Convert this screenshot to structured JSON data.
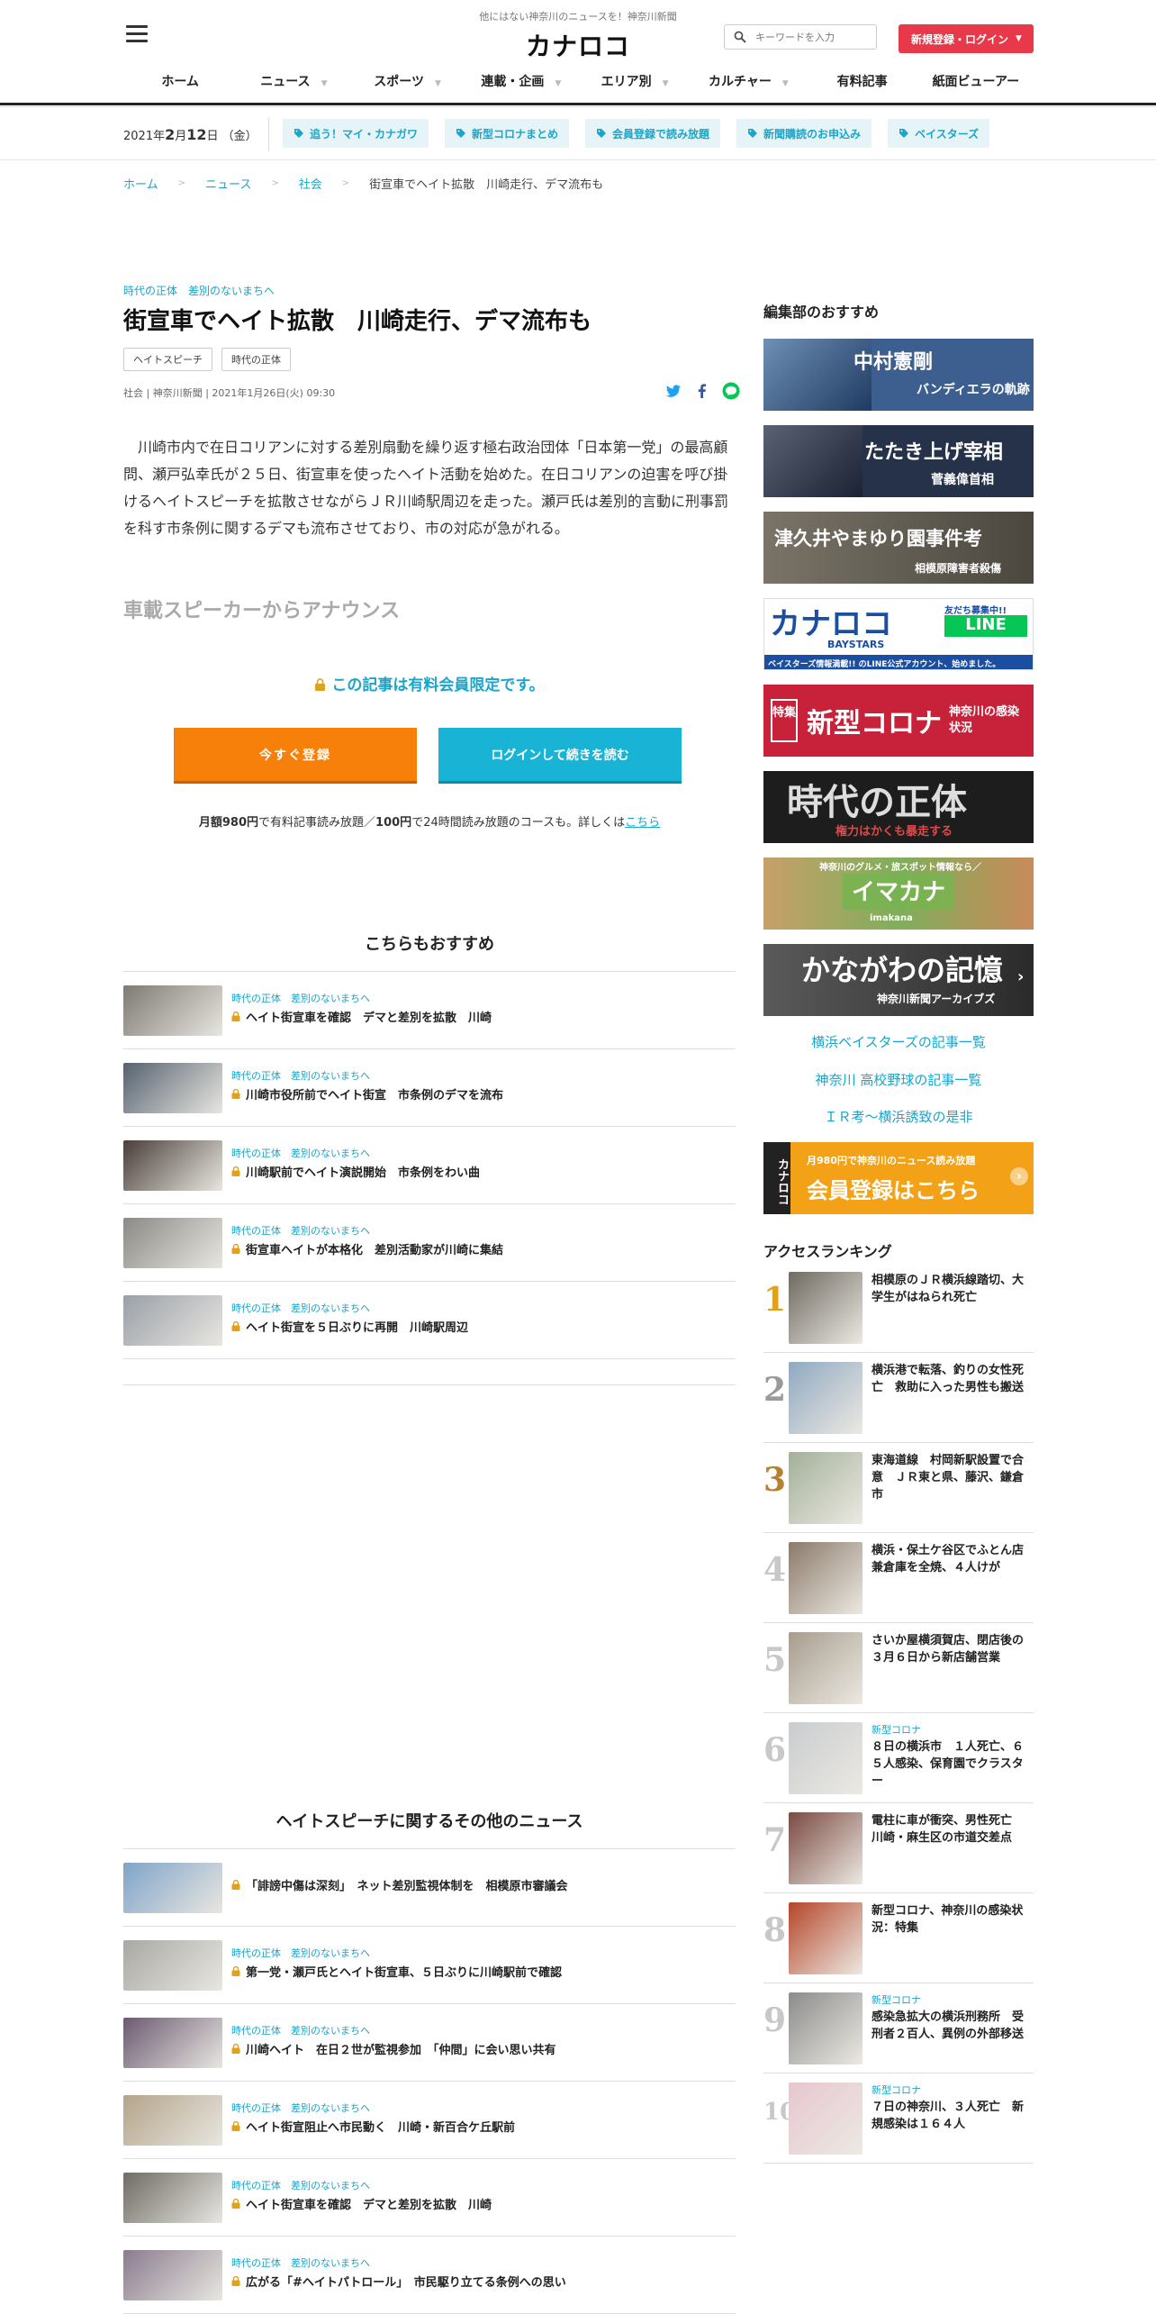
{
  "header": {
    "tagline": "他にはない神奈川のニュースを！神奈川新聞",
    "logo": "カナロコ",
    "search_placeholder": "キーワードを入力",
    "signup_label": "新規登録・ログイン"
  },
  "nav": [
    {
      "label": "ホーム",
      "dropdown": false
    },
    {
      "label": "ニュース",
      "dropdown": true
    },
    {
      "label": "スポーツ",
      "dropdown": true
    },
    {
      "label": "連載・企画",
      "dropdown": true
    },
    {
      "label": "エリア別",
      "dropdown": true
    },
    {
      "label": "カルチャー",
      "dropdown": true
    },
    {
      "label": "有料記事",
      "dropdown": false
    },
    {
      "label": "紙面ビューアー",
      "dropdown": false
    }
  ],
  "datebar": {
    "year": "2021年",
    "month_day_1": "2",
    "month_label": "月",
    "day": "12",
    "day_label": "日",
    "weekday": "（金）",
    "tags": [
      "追う！マイ・カナガワ",
      "新型コロナまとめ",
      "会員登録で読み放題",
      "新聞購読のお申込み",
      "ベイスターズ"
    ]
  },
  "breadcrumb": [
    "ホーム",
    "ニュース",
    "社会",
    "街宣車でヘイト拡散　川崎走行、デマ流布も"
  ],
  "article": {
    "kicker": "時代の正体　差別のないまちへ",
    "title": "街宣車でヘイト拡散　川崎走行、デマ流布も",
    "labels": [
      "ヘイトスピーチ",
      "時代の正体"
    ],
    "meta": "社会 | 神奈川新聞 | 2021年1月26日(火) 09:30",
    "body": "川崎市内で在日コリアンに対する差別扇動を繰り返す極右政治団体「日本第一党」の最高顧問、瀬戸弘幸氏が２５日、街宣車を使ったヘイト活動を始めた。在日コリアンの迫害を呼び掛けるヘイトスピーチを拡散させながらＪＲ川崎駅周辺を走った。瀬戸氏は差別的言動に刑事罰を科す市条例に関するデマも流布させており、市の対応が急がれる。",
    "subhead": "車載スピーカーからアナウンス",
    "paywall_msg": "この記事は有料会員限定です。",
    "register_btn": "今すぐ登録",
    "login_btn": "ログインして続きを読む",
    "plan_note": {
      "price1": "月額980円",
      "text1": "で有料記事読み放題／",
      "price2": "100円",
      "text2": "で24時間読み放題のコースも。詳しくは",
      "link": "こちら"
    }
  },
  "recommend": {
    "title": "こちらもおすすめ",
    "items": [
      {
        "kicker": "時代の正体　差別のないまちへ",
        "title": "ヘイト街宣車を確認　デマと差別を拡散　川崎",
        "thumb": "#7d7a72"
      },
      {
        "kicker": "時代の正体　差別のないまちへ",
        "title": "川崎市役所前でヘイト街宣　市条例のデマを流布",
        "thumb": "#566270"
      },
      {
        "kicker": "時代の正体　差別のないまちへ",
        "title": "川崎駅前でヘイト演説開始　市条例をわい曲",
        "thumb": "#4a3f3a"
      },
      {
        "kicker": "時代の正体　差別のないまちへ",
        "title": "街宣車ヘイトが本格化　差別活動家が川崎に集結",
        "thumb": "#8c8a86"
      },
      {
        "kicker": "時代の正体　差別のないまちへ",
        "title": "ヘイト街宣を５日ぶりに再開　川崎駅周辺",
        "thumb": "#9aa0a8"
      }
    ]
  },
  "related": {
    "title": "ヘイトスピーチに関するその他のニュース",
    "items": [
      {
        "kicker": "",
        "title": "「誹謗中傷は深刻」　ネット差別監視体制を　相模原市審議会",
        "thumb": "#7fa4c9"
      },
      {
        "kicker": "時代の正体　差別のないまちへ",
        "title": "第一党・瀬戸氏とヘイト街宣車、５日ぶりに川崎駅前で確認",
        "thumb": "#a9a8a2"
      },
      {
        "kicker": "時代の正体　差別のないまちへ",
        "title": "川崎ヘイト　在日２世が監視参加　「仲間」に会い思い共有",
        "thumb": "#6b5a72"
      },
      {
        "kicker": "時代の正体　差別のないまちへ",
        "title": "ヘイト街宣阻止へ市民動く　川崎・新百合ケ丘駅前",
        "thumb": "#b4a48a"
      },
      {
        "kicker": "時代の正体　差別のないまちへ",
        "title": "ヘイト街宣車を確認　デマと差別を拡散　川崎",
        "thumb": "#6f6c66"
      },
      {
        "kicker": "時代の正体　差別のないまちへ",
        "title": "広がる「#ヘイトパトロール」　市民駆り立てる条例への思い",
        "thumb": "#8a7c8e"
      }
    ]
  },
  "sidebar": {
    "editors_title": "編集部のおすすめ",
    "banners": [
      {
        "line1": "中村憲剛",
        "line2": "バンディエラの軌跡",
        "bg": "#3d5f8f"
      },
      {
        "line1": "たたき上げ宰相",
        "line2": "菅義偉首相",
        "bg": "#26324a"
      },
      {
        "line1": "津久井やまゆり園事件考",
        "line2": "相模原障害者殺傷",
        "bg": "#5c574f"
      },
      {
        "line1": "カナロコ",
        "line2": "BAYSTARS",
        "line3": "友だち募集中!!",
        "line4": "LINE",
        "line5": "ベイスターズ情報満載!! のLINE公式アカウント、始めました。",
        "bg": "#ffffff"
      },
      {
        "line1": "新型コロナ",
        "line2": "神奈川の感染状況",
        "tag": "特集",
        "bg": "#c8213a"
      },
      {
        "line1": "時代の正体",
        "line2": "権力はかくも暴走する",
        "bg": "#1d1d1d"
      },
      {
        "line1": "イマカナ",
        "line2": "神奈川のグルメ・旅スポット情報なら／",
        "line3": "imakana",
        "bg": "#7fae5a"
      },
      {
        "line1": "かながわの記憶",
        "line2": "神奈川新聞アーカイブズ",
        "bg": "#3a3a3a"
      }
    ],
    "links": [
      "横浜ベイスターズの記事一覧",
      "神奈川 高校野球の記事一覧",
      "ＩＲ考～横浜誘致の是非"
    ],
    "member_banner": {
      "logo": "カナロコ",
      "line1": "月980円で神奈川のニュース読み放題",
      "line2": "会員登録はこちら"
    },
    "ranking_title": "アクセスランキング",
    "ranking": [
      {
        "num": "1",
        "tag": "",
        "title": "相模原のＪＲ横浜線踏切、大学生がはねられ死亡",
        "thumb": "#6e6a62"
      },
      {
        "num": "2",
        "tag": "",
        "title": "横浜港で転落、釣りの女性死亡　救助に入った男性も搬送",
        "thumb": "#8fa9c2"
      },
      {
        "num": "3",
        "tag": "",
        "title": "東海道線　村岡新駅設置で合意　ＪＲ東と県、藤沢、鎌倉市",
        "thumb": "#a3b09a"
      },
      {
        "num": "4",
        "tag": "",
        "title": "横浜・保土ケ谷区でふとん店兼倉庫を全焼、４人けが",
        "thumb": "#8b7a6a"
      },
      {
        "num": "5",
        "tag": "",
        "title": "さいか屋横須賀店、閉店後の３月６日から新店舗営業",
        "thumb": "#a79d8e"
      },
      {
        "num": "6",
        "tag": "新型コロナ",
        "title": "８日の横浜市　１人死亡、６５人感染、保育園でクラスター",
        "thumb": "#c9ccd0"
      },
      {
        "num": "7",
        "tag": "",
        "title": "電柱に車が衝突、男性死亡　川崎・麻生区の市道交差点",
        "thumb": "#7a4a42"
      },
      {
        "num": "8",
        "tag": "",
        "title": "新型コロナ、神奈川の感染状況：特集",
        "thumb": "#b5462a"
      },
      {
        "num": "9",
        "tag": "新型コロナ",
        "title": "感染急拡大の横浜刑務所　受刑者２百人、異例の外部移送",
        "thumb": "#8c8c8c"
      },
      {
        "num": "10",
        "tag": "新型コロナ",
        "title": "７日の神奈川、３人死亡　新規感染は１６４人",
        "thumb": "#e6c7d0"
      }
    ]
  },
  "colors": {
    "accent": "#1ba5c8",
    "signup": "#e8394a",
    "register": "#f7800a",
    "login": "#19b3d6",
    "rank1": "#e0a21a",
    "rank3": "#b8812e"
  }
}
